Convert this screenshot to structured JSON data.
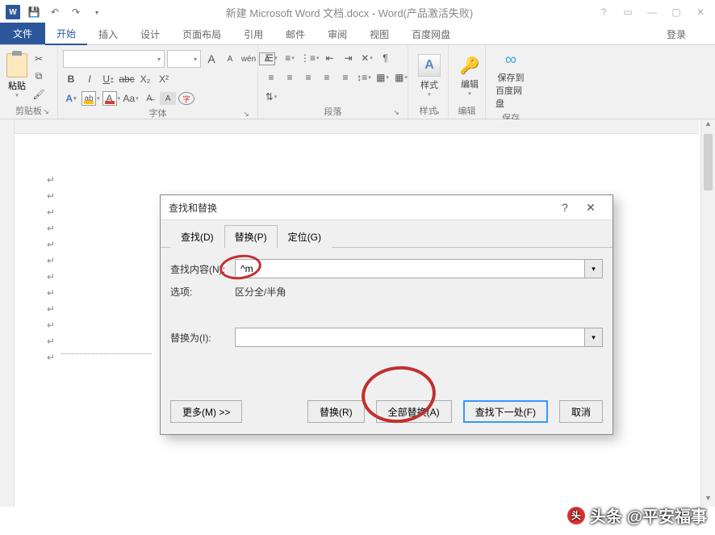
{
  "title": {
    "doc": "新建 Microsoft Word 文档.docx - Word(产品激活失败)"
  },
  "tabs": {
    "file": "文件",
    "home": "开始",
    "insert": "插入",
    "design": "设计",
    "layout": "页面布局",
    "references": "引用",
    "mailings": "邮件",
    "review": "审阅",
    "view": "视图",
    "baidu": "百度网盘",
    "login": "登录"
  },
  "groups": {
    "clipboard": "剪贴板",
    "font": "字体",
    "paragraph": "段落",
    "styles": "样式",
    "editing": "编辑",
    "baidu_save": "保存"
  },
  "buttons": {
    "paste": "粘贴",
    "styles": "样式",
    "editing": "编辑",
    "baidu_save": "保存到",
    "baidu_save2": "百度网盘"
  },
  "font": {
    "wen": "wén",
    "aa": "A",
    "b": "B",
    "i": "I",
    "u": "U",
    "abc": "abc",
    "x2": "X₂",
    "x2u": "X²",
    "clear": "A",
    "sizeup": "A",
    "sizedown": "A"
  },
  "dialog": {
    "title": "查找和替换",
    "tab_find": "查找(D)",
    "tab_replace": "替换(P)",
    "tab_goto": "定位(G)",
    "find_label": "查找内容(N):",
    "find_value": "^m",
    "options_label": "选项:",
    "options_value": "区分全/半角",
    "replace_label": "替换为(I):",
    "replace_value": "",
    "more": "更多(M) >>",
    "replace": "替换(R)",
    "replace_all": "全部替换(A)",
    "find_next": "查找下一处(F)",
    "cancel": "取消"
  },
  "watermark": {
    "text": "头条 @平安福事"
  }
}
